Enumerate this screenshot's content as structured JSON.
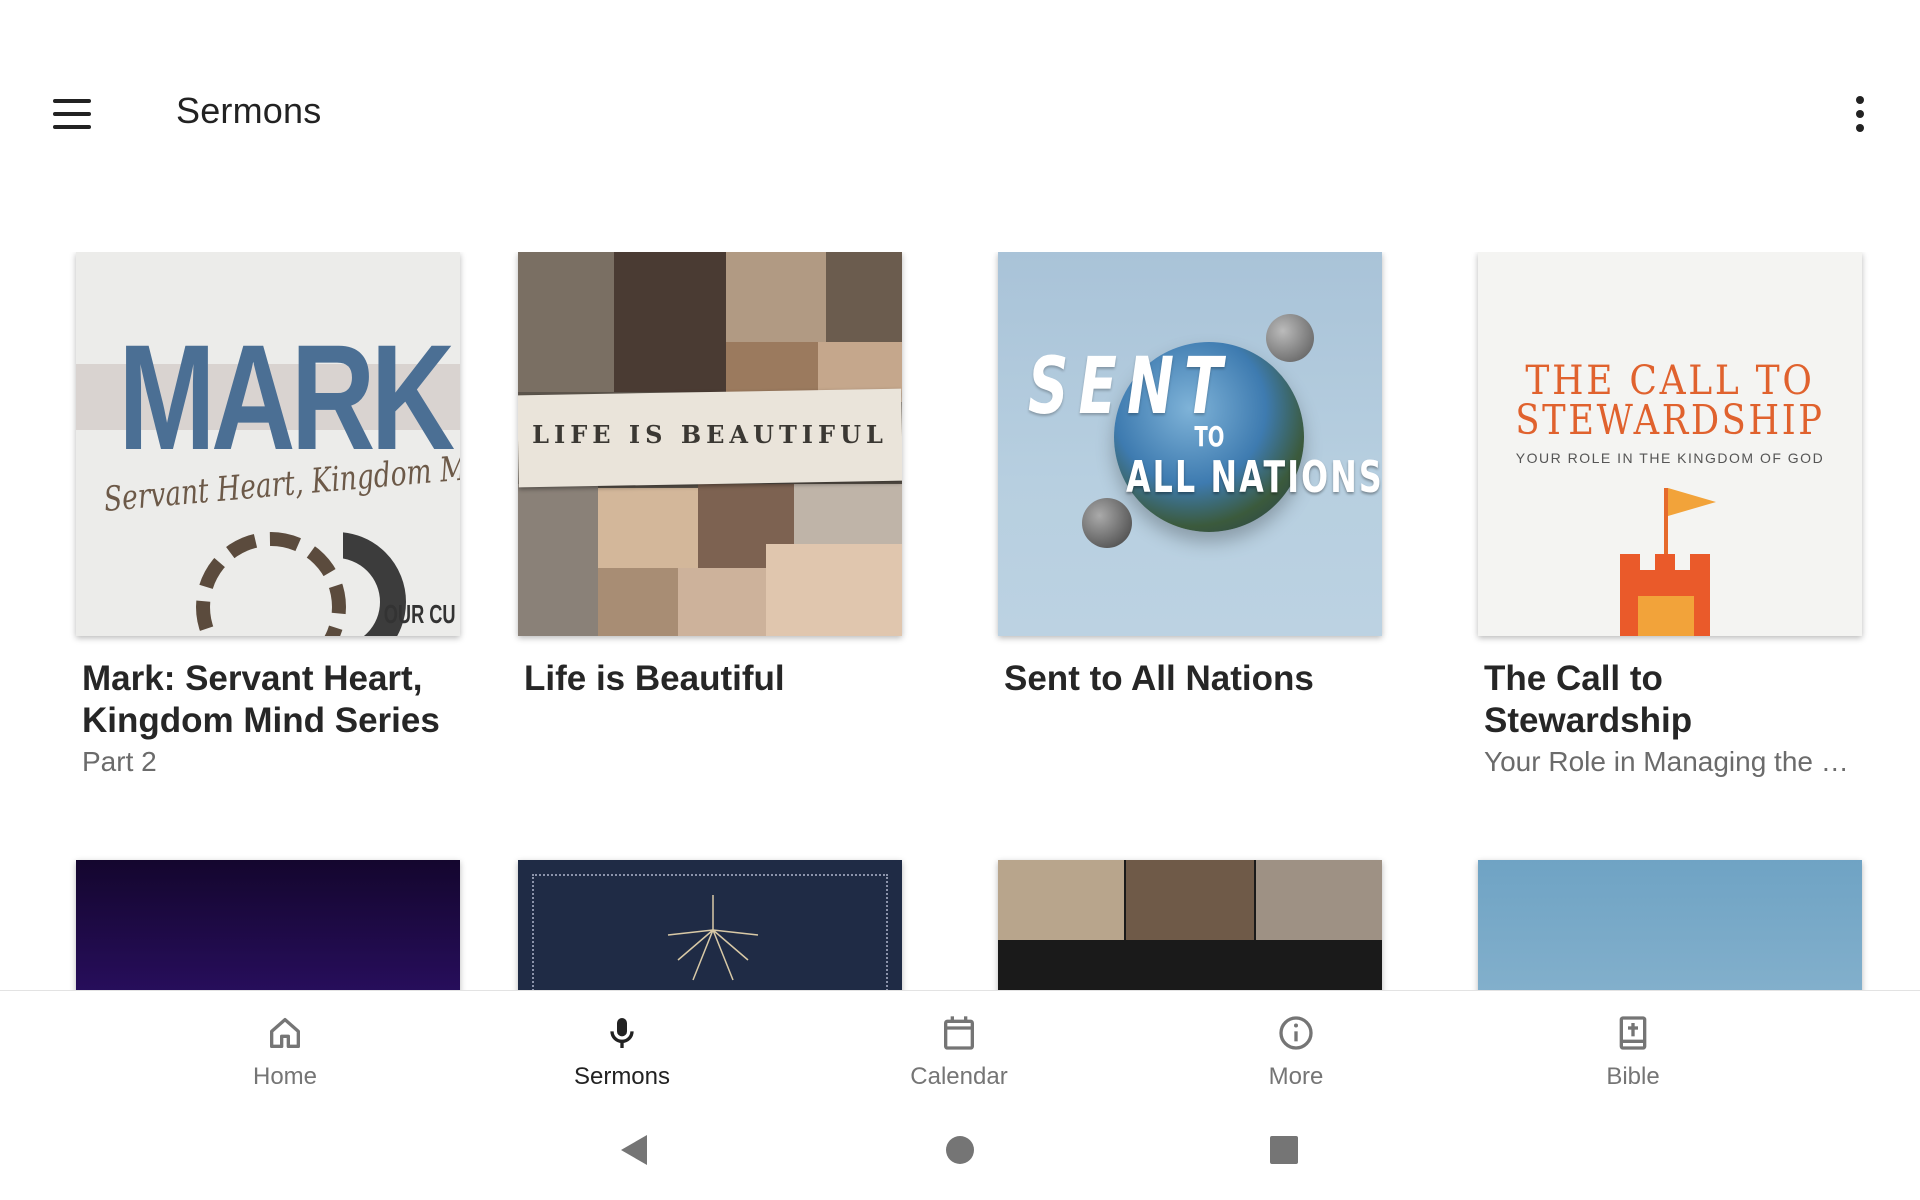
{
  "app_bar": {
    "title": "Sermons",
    "menu_icon": "hamburger-menu-icon",
    "overflow_icon": "more-vert-icon"
  },
  "series": [
    {
      "title": "Mark: Servant Heart, Kingdom Mind Series",
      "subtitle": "Part 2",
      "artwork": {
        "headline": "MARK",
        "tagline": "Servant Heart, Kingdom Mind",
        "corner": "OUR CU"
      }
    },
    {
      "title": "Life is Beautiful",
      "subtitle": "",
      "artwork": {
        "headline": "LIFE IS BEAUTIFUL"
      }
    },
    {
      "title": "Sent to All Nations",
      "subtitle": "",
      "artwork": {
        "word1": "SENT",
        "word2": "TO",
        "word3": "ALL NATIONS"
      }
    },
    {
      "title": "The Call to Stewardship",
      "subtitle": "Your Role in Managing the K...",
      "artwork": {
        "line1": "THE CALL TO",
        "line2": "STEWARDSHIP",
        "line3": "YOUR ROLE IN THE KINGDOM OF GOD"
      }
    }
  ],
  "bottom_nav": [
    {
      "label": "Home",
      "icon": "home-icon",
      "active": false
    },
    {
      "label": "Sermons",
      "icon": "microphone-icon",
      "active": true
    },
    {
      "label": "Calendar",
      "icon": "calendar-icon",
      "active": false
    },
    {
      "label": "More",
      "icon": "info-icon",
      "active": false
    },
    {
      "label": "Bible",
      "icon": "bible-icon",
      "active": false
    }
  ],
  "system_nav": {
    "back_icon": "back-triangle-icon",
    "home_icon": "home-circle-icon",
    "recents_icon": "recents-square-icon"
  },
  "colors": {
    "active_nav": "#222222",
    "inactive_nav": "#757575",
    "stewardship_accent": "#e0622e",
    "mark_blue": "#4b6f94"
  }
}
